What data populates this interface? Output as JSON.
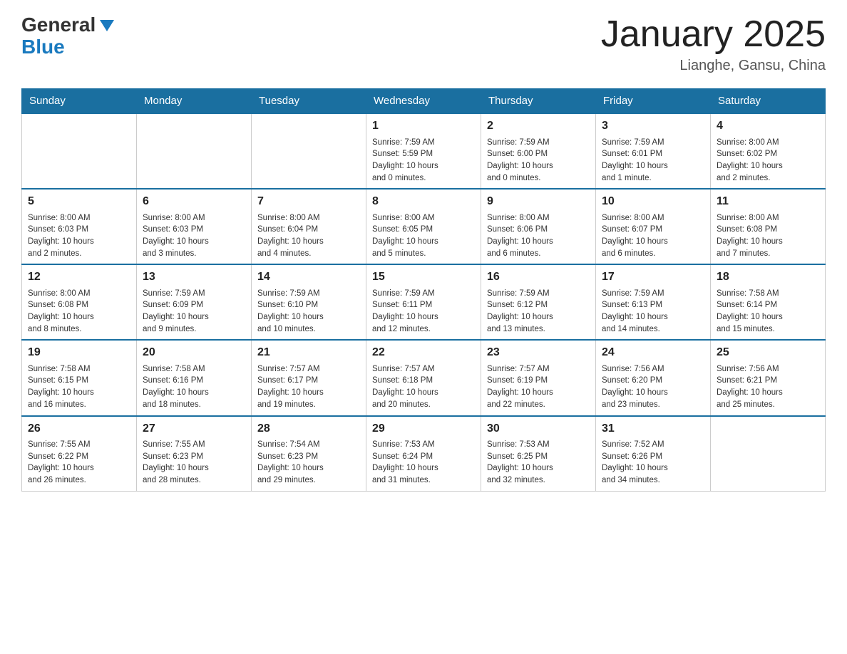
{
  "logo": {
    "general": "General",
    "blue": "Blue"
  },
  "title": "January 2025",
  "subtitle": "Lianghe, Gansu, China",
  "days_of_week": [
    "Sunday",
    "Monday",
    "Tuesday",
    "Wednesday",
    "Thursday",
    "Friday",
    "Saturday"
  ],
  "weeks": [
    [
      {
        "day": "",
        "info": ""
      },
      {
        "day": "",
        "info": ""
      },
      {
        "day": "",
        "info": ""
      },
      {
        "day": "1",
        "info": "Sunrise: 7:59 AM\nSunset: 5:59 PM\nDaylight: 10 hours\nand 0 minutes."
      },
      {
        "day": "2",
        "info": "Sunrise: 7:59 AM\nSunset: 6:00 PM\nDaylight: 10 hours\nand 0 minutes."
      },
      {
        "day": "3",
        "info": "Sunrise: 7:59 AM\nSunset: 6:01 PM\nDaylight: 10 hours\nand 1 minute."
      },
      {
        "day": "4",
        "info": "Sunrise: 8:00 AM\nSunset: 6:02 PM\nDaylight: 10 hours\nand 2 minutes."
      }
    ],
    [
      {
        "day": "5",
        "info": "Sunrise: 8:00 AM\nSunset: 6:03 PM\nDaylight: 10 hours\nand 2 minutes."
      },
      {
        "day": "6",
        "info": "Sunrise: 8:00 AM\nSunset: 6:03 PM\nDaylight: 10 hours\nand 3 minutes."
      },
      {
        "day": "7",
        "info": "Sunrise: 8:00 AM\nSunset: 6:04 PM\nDaylight: 10 hours\nand 4 minutes."
      },
      {
        "day": "8",
        "info": "Sunrise: 8:00 AM\nSunset: 6:05 PM\nDaylight: 10 hours\nand 5 minutes."
      },
      {
        "day": "9",
        "info": "Sunrise: 8:00 AM\nSunset: 6:06 PM\nDaylight: 10 hours\nand 6 minutes."
      },
      {
        "day": "10",
        "info": "Sunrise: 8:00 AM\nSunset: 6:07 PM\nDaylight: 10 hours\nand 6 minutes."
      },
      {
        "day": "11",
        "info": "Sunrise: 8:00 AM\nSunset: 6:08 PM\nDaylight: 10 hours\nand 7 minutes."
      }
    ],
    [
      {
        "day": "12",
        "info": "Sunrise: 8:00 AM\nSunset: 6:08 PM\nDaylight: 10 hours\nand 8 minutes."
      },
      {
        "day": "13",
        "info": "Sunrise: 7:59 AM\nSunset: 6:09 PM\nDaylight: 10 hours\nand 9 minutes."
      },
      {
        "day": "14",
        "info": "Sunrise: 7:59 AM\nSunset: 6:10 PM\nDaylight: 10 hours\nand 10 minutes."
      },
      {
        "day": "15",
        "info": "Sunrise: 7:59 AM\nSunset: 6:11 PM\nDaylight: 10 hours\nand 12 minutes."
      },
      {
        "day": "16",
        "info": "Sunrise: 7:59 AM\nSunset: 6:12 PM\nDaylight: 10 hours\nand 13 minutes."
      },
      {
        "day": "17",
        "info": "Sunrise: 7:59 AM\nSunset: 6:13 PM\nDaylight: 10 hours\nand 14 minutes."
      },
      {
        "day": "18",
        "info": "Sunrise: 7:58 AM\nSunset: 6:14 PM\nDaylight: 10 hours\nand 15 minutes."
      }
    ],
    [
      {
        "day": "19",
        "info": "Sunrise: 7:58 AM\nSunset: 6:15 PM\nDaylight: 10 hours\nand 16 minutes."
      },
      {
        "day": "20",
        "info": "Sunrise: 7:58 AM\nSunset: 6:16 PM\nDaylight: 10 hours\nand 18 minutes."
      },
      {
        "day": "21",
        "info": "Sunrise: 7:57 AM\nSunset: 6:17 PM\nDaylight: 10 hours\nand 19 minutes."
      },
      {
        "day": "22",
        "info": "Sunrise: 7:57 AM\nSunset: 6:18 PM\nDaylight: 10 hours\nand 20 minutes."
      },
      {
        "day": "23",
        "info": "Sunrise: 7:57 AM\nSunset: 6:19 PM\nDaylight: 10 hours\nand 22 minutes."
      },
      {
        "day": "24",
        "info": "Sunrise: 7:56 AM\nSunset: 6:20 PM\nDaylight: 10 hours\nand 23 minutes."
      },
      {
        "day": "25",
        "info": "Sunrise: 7:56 AM\nSunset: 6:21 PM\nDaylight: 10 hours\nand 25 minutes."
      }
    ],
    [
      {
        "day": "26",
        "info": "Sunrise: 7:55 AM\nSunset: 6:22 PM\nDaylight: 10 hours\nand 26 minutes."
      },
      {
        "day": "27",
        "info": "Sunrise: 7:55 AM\nSunset: 6:23 PM\nDaylight: 10 hours\nand 28 minutes."
      },
      {
        "day": "28",
        "info": "Sunrise: 7:54 AM\nSunset: 6:23 PM\nDaylight: 10 hours\nand 29 minutes."
      },
      {
        "day": "29",
        "info": "Sunrise: 7:53 AM\nSunset: 6:24 PM\nDaylight: 10 hours\nand 31 minutes."
      },
      {
        "day": "30",
        "info": "Sunrise: 7:53 AM\nSunset: 6:25 PM\nDaylight: 10 hours\nand 32 minutes."
      },
      {
        "day": "31",
        "info": "Sunrise: 7:52 AM\nSunset: 6:26 PM\nDaylight: 10 hours\nand 34 minutes."
      },
      {
        "day": "",
        "info": ""
      }
    ]
  ]
}
